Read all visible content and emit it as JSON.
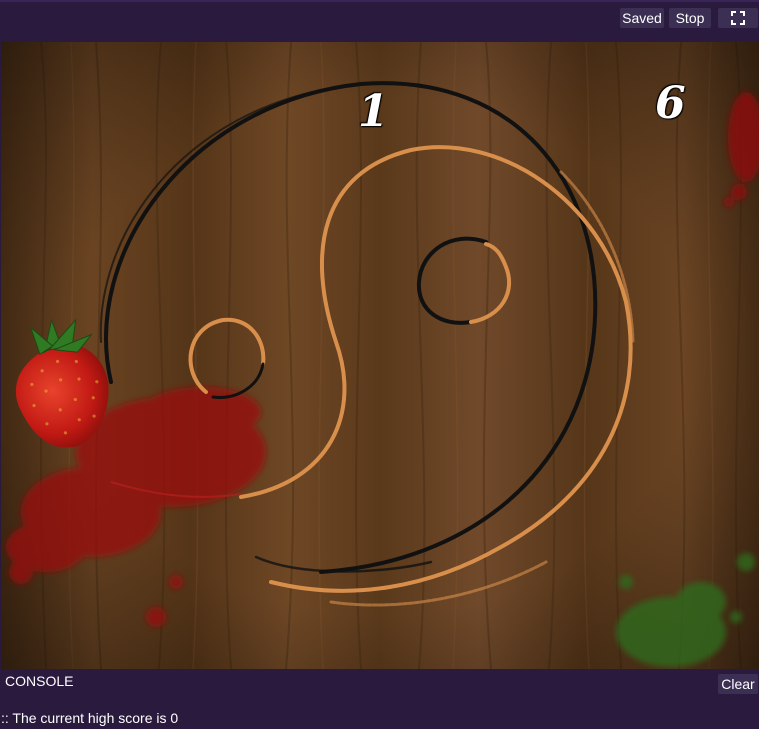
{
  "toolbar": {
    "saved_label": "Saved",
    "stop_label": "Stop",
    "fullscreen_icon": "fullscreen-icon"
  },
  "game": {
    "score_left": "1",
    "score_right": "6",
    "fruit": "strawberry",
    "colors": {
      "wood": "#5a3a1e",
      "juice_red": "#9a0f10",
      "juice_green": "#2f6b1a",
      "ring_dark": "#111111",
      "ring_orange": "#d98f4c"
    }
  },
  "console": {
    "title": "CONSOLE",
    "clear_label": "Clear",
    "lines": [
      ":: The current high score is 0"
    ]
  }
}
